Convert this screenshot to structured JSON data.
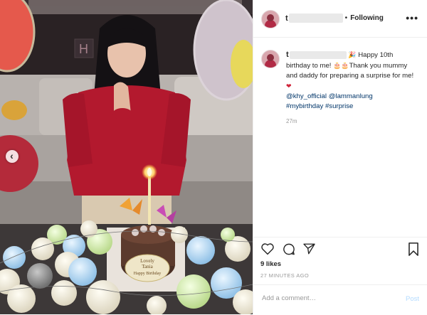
{
  "post": {
    "username_visible": "t",
    "follow_status": "Following",
    "dot": "•",
    "more_icon": "ellipsis-icon",
    "caption": {
      "username_visible": "t",
      "part1": "Happy 10th birthday to me!",
      "part2": "Thank you mummy and daddy for preparing a surprise for me!",
      "mention1": "@khy_official",
      "mention2": "@lammanlung",
      "tag1": "#mybirthday",
      "tag2": "#surprise",
      "time_ago": "27m"
    },
    "likes": "9 likes",
    "posted": "27 MINUTES AGO",
    "comment_placeholder": "Add a comment…",
    "post_label": "Post"
  },
  "photo": {
    "cake_text_line1": "Lovely",
    "cake_text_line2": "Tania",
    "cake_text_line3": "Happy Birthday"
  },
  "colors": {
    "link": "#003569",
    "muted": "#999999",
    "post_disabled": "#b3dbff",
    "dress": "#b3192e"
  }
}
